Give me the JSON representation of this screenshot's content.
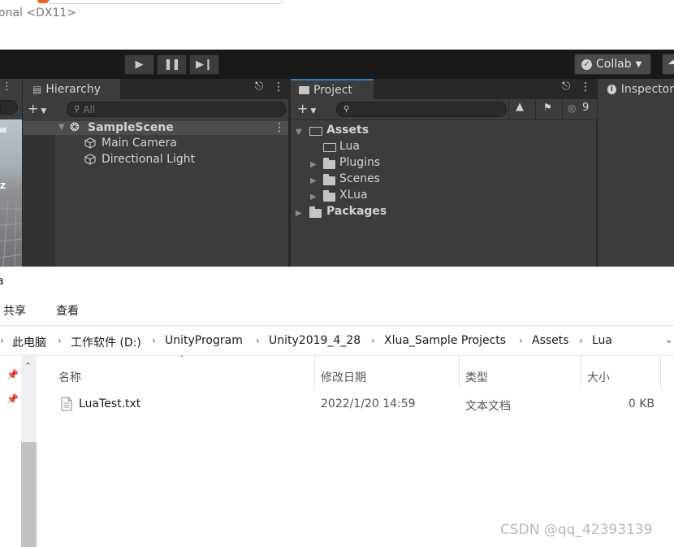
{
  "unity": {
    "window_title": "onal <DX11>",
    "toolbar": {
      "play_icon": "play-icon",
      "pause_icon": "pause-icon",
      "step_icon": "step-icon",
      "collab_label": "Collab"
    },
    "hierarchy": {
      "tab_label": "Hierarchy",
      "search_placeholder": "All",
      "scene": "SampleScene",
      "items": [
        "Main Camera",
        "Directional Light"
      ]
    },
    "project": {
      "tab_label": "Project",
      "visibility_count": "9",
      "tree": {
        "assets": "Assets",
        "children": [
          "Lua",
          "Plugins",
          "Scenes",
          "XLua"
        ],
        "packages": "Packages"
      }
    },
    "inspector": {
      "tab_label": "Inspector"
    },
    "scene_view": {
      "axis_label": "z"
    }
  },
  "explorer": {
    "window_fragment": "a",
    "ribbon_tabs": [
      "共享",
      "查看"
    ],
    "breadcrumb": [
      "此电脑",
      "工作软件 (D:)",
      "UnityProgram",
      "Unity2019_4_28",
      "Xlua_Sample Projects",
      "Assets",
      "Lua"
    ],
    "columns": {
      "name": "名称",
      "modified": "修改日期",
      "type": "类型",
      "size": "大小"
    },
    "files": [
      {
        "name": "LuaTest.txt",
        "modified": "2022/1/20 14:59",
        "type": "文本文档",
        "size": "0 KB"
      }
    ]
  },
  "watermark": "CSDN @qq_42393139"
}
